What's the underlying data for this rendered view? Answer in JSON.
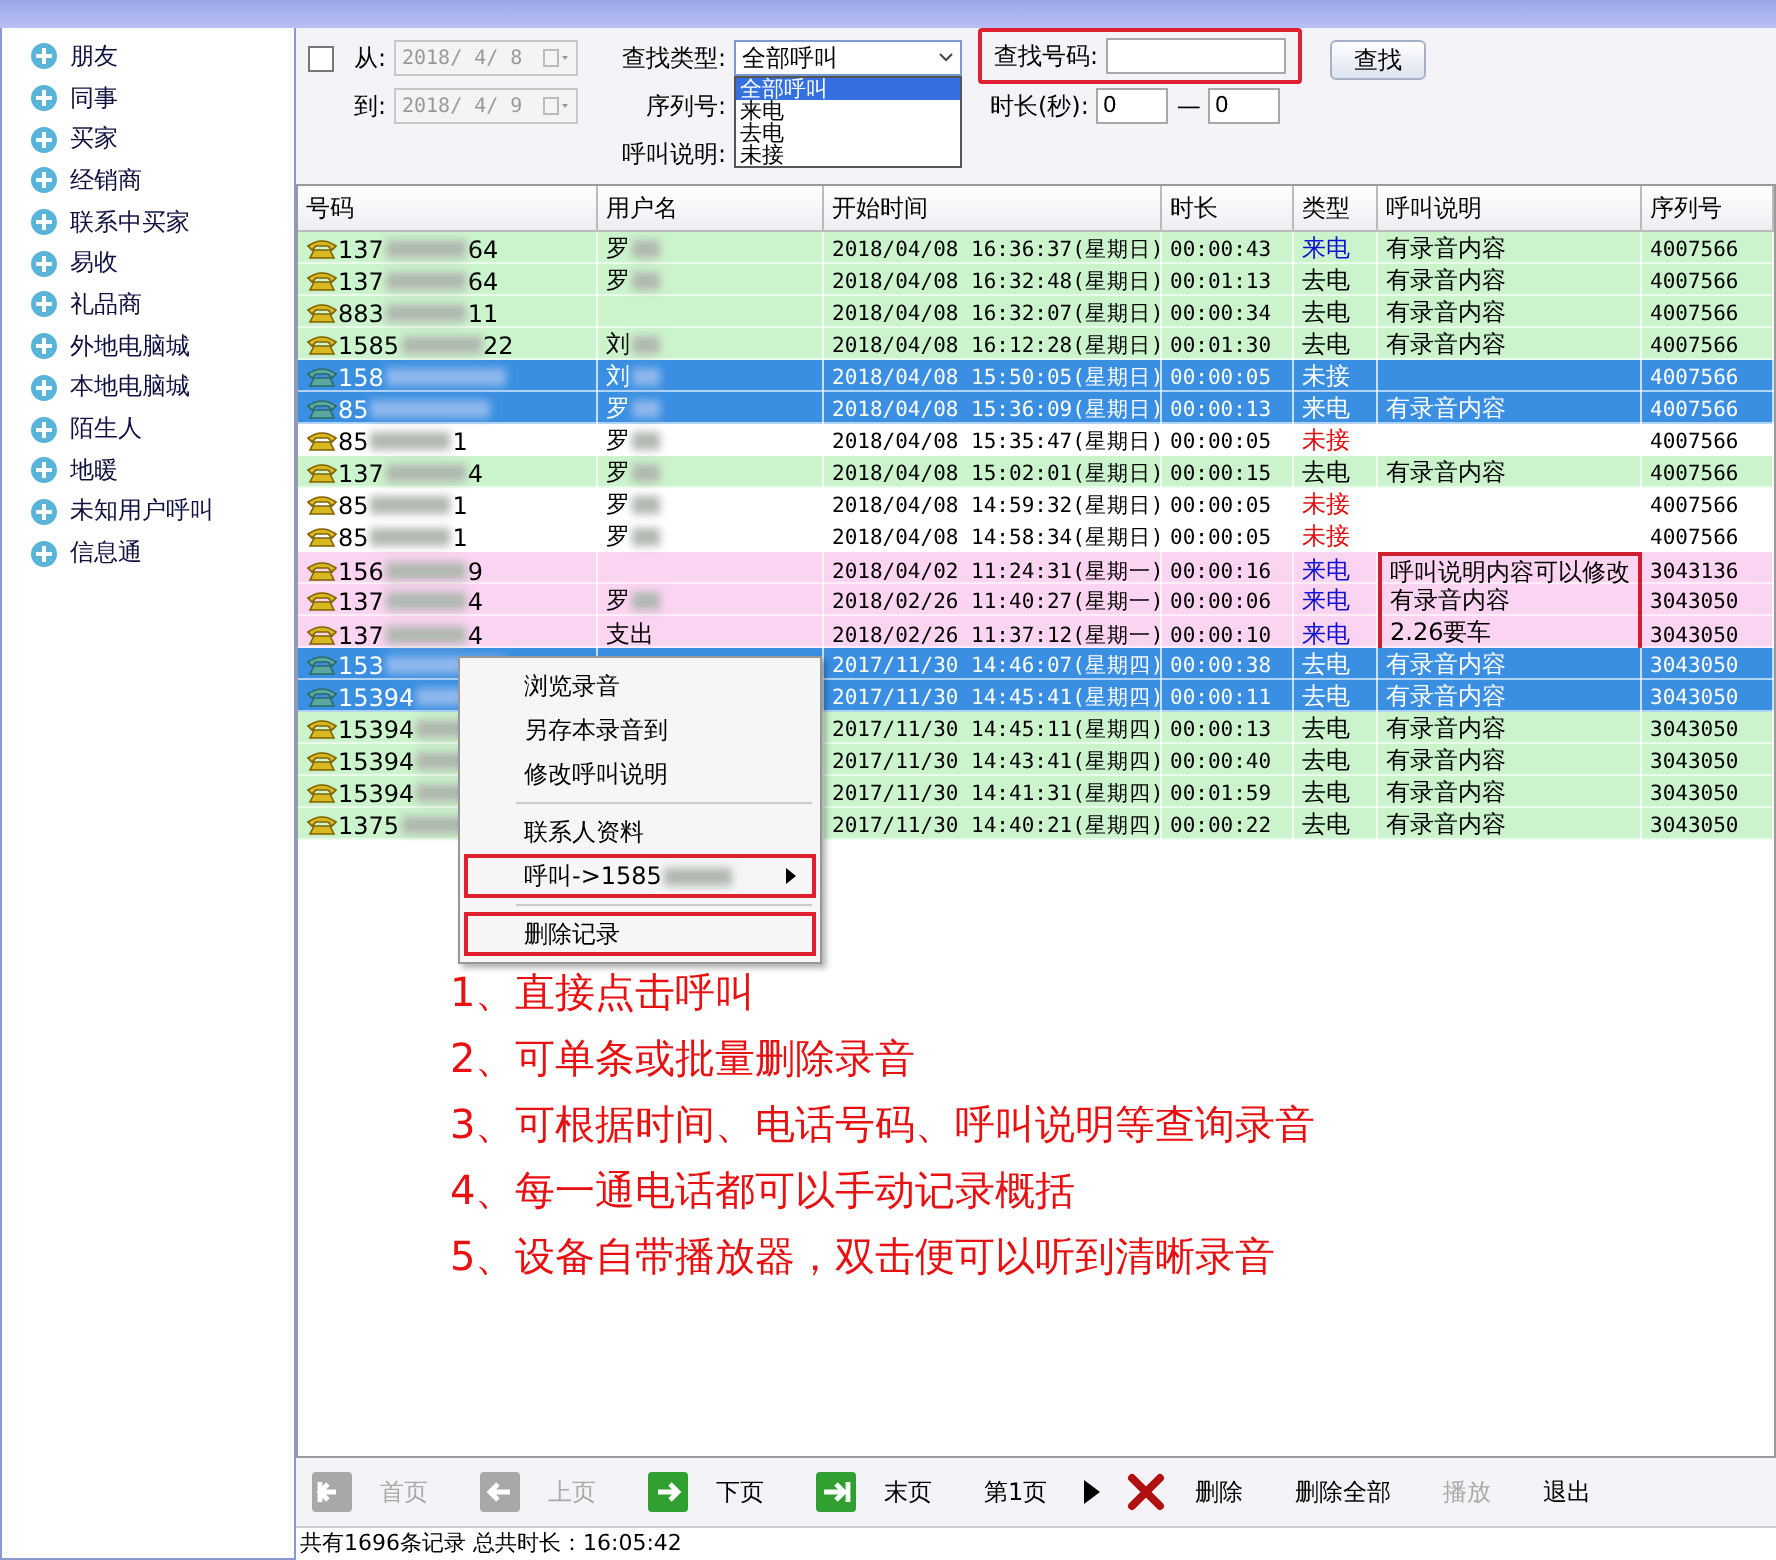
{
  "sidebar": {
    "items": [
      "朋友",
      "同事",
      "买家",
      "经销商",
      "联系中买家",
      "易收",
      "礼品商",
      "外地电脑城",
      "本地电脑城",
      "陌生人",
      "地暖",
      "未知用户呼叫",
      "信息通"
    ]
  },
  "filters": {
    "date_enabled": false,
    "from_label": "从:",
    "from_value": "2018/ 4/ 8",
    "to_label": "到:",
    "to_value": "2018/ 4/ 9",
    "type_label": "查找类型:",
    "type_value": "全部呼叫",
    "type_options": [
      {
        "label": "全部呼叫",
        "selected": true
      },
      {
        "label": "来电",
        "selected": false
      },
      {
        "label": "去电",
        "selected": false
      },
      {
        "label": "未接",
        "selected": false
      }
    ],
    "serial_label": "序列号:",
    "desc_label": "呼叫说明:",
    "number_label": "查找号码:",
    "number_highlighted": true,
    "search_button": "查找",
    "duration_label": "时长(秒):",
    "duration_from": "0",
    "duration_dash": "—",
    "duration_to": "0"
  },
  "table": {
    "columns": [
      "号码",
      "用户名",
      "开始时间",
      "时长",
      "类型",
      "呼叫说明",
      "序列号"
    ],
    "rows": [
      {
        "number_prefix": "137",
        "number_suffix": "64",
        "user": "罗",
        "user_masked": true,
        "start": "2018/04/08 16:36:37(星期日)",
        "duration": "00:00:43",
        "type": "来电",
        "incoming": true,
        "missed": false,
        "desc": "有录音内容",
        "serial": "4007566",
        "color": "#ccf4cc",
        "selected": false,
        "boxed": false
      },
      {
        "number_prefix": "137",
        "number_suffix": "64",
        "user": "罗",
        "user_masked": true,
        "start": "2018/04/08 16:32:48(星期日)",
        "duration": "00:01:13",
        "type": "去电",
        "incoming": false,
        "missed": false,
        "desc": "有录音内容",
        "serial": "4007566",
        "color": "#ccf4cc",
        "selected": false,
        "boxed": false
      },
      {
        "number_prefix": "883",
        "number_suffix": "11",
        "start": "2018/04/08 16:32:07(星期日)",
        "duration": "00:00:34",
        "type": "去电",
        "incoming": false,
        "missed": false,
        "desc": "有录音内容",
        "serial": "4007566",
        "color": "#ccf4cc",
        "selected": false,
        "boxed": false
      },
      {
        "number_prefix": "1585",
        "number_suffix": "22",
        "user": "刘",
        "user_masked": true,
        "start": "2018/04/08 16:12:28(星期日)",
        "duration": "00:01:30",
        "type": "去电",
        "incoming": false,
        "missed": false,
        "desc": "有录音内容",
        "serial": "4007566",
        "color": "#ccf4cc",
        "selected": false,
        "boxed": false
      },
      {
        "number_prefix": "158",
        "user": "刘",
        "user_masked": true,
        "start": "2018/04/08 15:50:05(星期日)",
        "duration": "00:00:05",
        "type": "未接",
        "serial": "4007566",
        "selected": true,
        "boxed": false
      },
      {
        "number_prefix": "85",
        "user": "罗",
        "user_masked": true,
        "start": "2018/04/08 15:36:09(星期日)",
        "duration": "00:00:13",
        "type": "来电",
        "desc": "有录音内容",
        "serial": "4007566",
        "selected": true,
        "boxed": false
      },
      {
        "number_prefix": "85",
        "number_suffix": "1",
        "user": "罗",
        "user_masked": true,
        "start": "2018/04/08 15:35:47(星期日)",
        "duration": "00:00:05",
        "type": "未接",
        "missed": true,
        "serial": "4007566",
        "color": "#ffffff",
        "selected": false,
        "boxed": false
      },
      {
        "number_prefix": "137",
        "number_suffix": "4",
        "user": "罗",
        "user_masked": true,
        "start": "2018/04/08 15:02:01(星期日)",
        "duration": "00:00:15",
        "type": "去电",
        "incoming": false,
        "missed": false,
        "desc": "有录音内容",
        "serial": "4007566",
        "color": "#ccf4cc",
        "selected": false,
        "boxed": false
      },
      {
        "number_prefix": "85",
        "number_suffix": "1",
        "user": "罗",
        "user_masked": true,
        "start": "2018/04/08 14:59:32(星期日)",
        "duration": "00:00:05",
        "type": "未接",
        "missed": true,
        "serial": "4007566",
        "color": "#ffffff",
        "selected": false,
        "boxed": false
      },
      {
        "number_prefix": "85",
        "number_suffix": "1",
        "user": "罗",
        "user_masked": true,
        "start": "2018/04/08 14:58:34(星期日)",
        "duration": "00:00:05",
        "type": "未接",
        "missed": true,
        "serial": "4007566",
        "color": "#ffffff",
        "selected": false,
        "boxed": false
      },
      {
        "number_prefix": "156",
        "number_suffix": "9",
        "start": "2018/04/02 11:24:31(星期一)",
        "duration": "00:00:16",
        "type": "来电",
        "incoming": true,
        "missed": false,
        "desc": "呼叫说明内容可以修改",
        "serial": "3043136",
        "color": "#fbd4f2",
        "selected": false,
        "boxed": true
      },
      {
        "number_prefix": "137",
        "number_suffix": "4",
        "user": "罗",
        "user_masked": true,
        "start": "2018/02/26 11:40:27(星期一)",
        "duration": "00:00:06",
        "type": "来电",
        "incoming": true,
        "missed": false,
        "desc": "有录音内容",
        "serial": "3043050",
        "color": "#fbd4f2",
        "selected": false,
        "boxed": true
      },
      {
        "number_prefix": "137",
        "number_suffix": "4",
        "user": "支出",
        "user_masked": false,
        "start": "2018/02/26 11:37:12(星期一)",
        "duration": "00:00:10",
        "type": "来电",
        "incoming": true,
        "missed": false,
        "desc": "2.26要车",
        "serial": "3043050",
        "color": "#fbd4f2",
        "selected": false,
        "boxed": true
      },
      {
        "number_prefix": "153",
        "start": "2017/11/30 14:46:07(星期四)",
        "duration": "00:00:38",
        "type": "去电",
        "desc": "有录音内容",
        "serial": "3043050",
        "selected": true,
        "boxed": false
      },
      {
        "number_prefix": "15394",
        "start": "2017/11/30 14:45:41(星期四)",
        "duration": "00:00:11",
        "type": "去电",
        "desc": "有录音内容",
        "serial": "3043050",
        "selected": true,
        "boxed": false
      },
      {
        "number_prefix": "15394",
        "start": "2017/11/30 14:45:11(星期四)",
        "duration": "00:00:13",
        "type": "去电",
        "incoming": false,
        "missed": false,
        "desc": "有录音内容",
        "serial": "3043050",
        "color": "#ccf4cc",
        "selected": false,
        "boxed": false
      },
      {
        "number_prefix": "15394",
        "start": "2017/11/30 14:43:41(星期四)",
        "duration": "00:00:40",
        "type": "去电",
        "incoming": false,
        "missed": false,
        "desc": "有录音内容",
        "serial": "3043050",
        "color": "#ccf4cc",
        "selected": false,
        "boxed": false
      },
      {
        "number_prefix": "15394",
        "start": "2017/11/30 14:41:31(星期四)",
        "duration": "00:01:59",
        "type": "去电",
        "incoming": false,
        "missed": false,
        "desc": "有录音内容",
        "serial": "3043050",
        "color": "#ccf4cc",
        "selected": false,
        "boxed": false
      },
      {
        "number_prefix": "1375",
        "start": "2017/11/30 14:40:21(星期四)",
        "duration": "00:00:22",
        "type": "去电",
        "incoming": false,
        "missed": false,
        "desc": "有录音内容",
        "serial": "3043050",
        "color": "#ccf4cc",
        "selected": false,
        "boxed": false
      }
    ]
  },
  "context_menu": {
    "items": [
      {
        "kind": "item",
        "label": "浏览录音",
        "highlighted": false
      },
      {
        "kind": "item",
        "label": "另存本录音到",
        "highlighted": false
      },
      {
        "kind": "item",
        "label": "修改呼叫说明",
        "highlighted": false
      },
      {
        "kind": "separator"
      },
      {
        "kind": "item",
        "label": "联系人资料",
        "highlighted": false
      },
      {
        "kind": "submenu",
        "label": "呼叫->1585",
        "highlighted": true
      },
      {
        "kind": "separator"
      },
      {
        "kind": "item",
        "label": "删除记录",
        "highlighted": true
      }
    ]
  },
  "notes": [
    "1、直接点击呼叫",
    "2、可单条或批量删除录音",
    "3、可根据时间、电话号码、呼叫说明等查询录音",
    "4、每一通电话都可以手动记录概括",
    "5、设备自带播放器，双击便可以听到清晰录音"
  ],
  "toolbar": [
    {
      "kind": "first",
      "label": "首页",
      "disabled": true
    },
    {
      "kind": "prev",
      "label": "上页",
      "disabled": true
    },
    {
      "kind": "next",
      "label": "下页",
      "disabled": false
    },
    {
      "kind": "last",
      "label": "末页",
      "disabled": false
    },
    {
      "kind": "plain",
      "label": "第1页",
      "disabled": false
    },
    {
      "kind": "arrow"
    },
    {
      "kind": "delete",
      "label": "删除",
      "disabled": false
    },
    {
      "kind": "plain",
      "label": "删除全部",
      "disabled": false
    },
    {
      "kind": "plain",
      "label": "播放",
      "disabled": true
    },
    {
      "kind": "plain",
      "label": "退出",
      "disabled": false
    }
  ],
  "status_bar": "共有1696条记录 总共时长：16:05:42"
}
